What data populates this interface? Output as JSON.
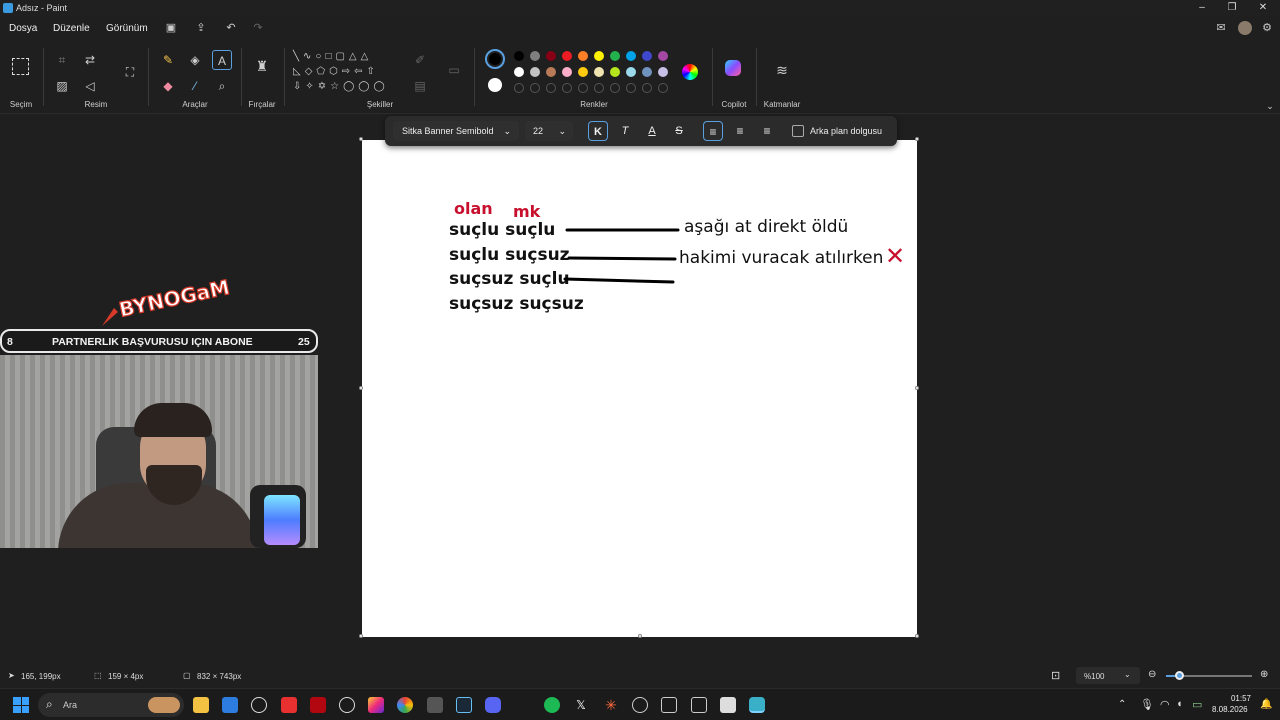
{
  "window": {
    "title": "Adsız - Paint"
  },
  "menu": {
    "file": "Dosya",
    "edit": "Düzenle",
    "view": "Görünüm"
  },
  "ribbon": {
    "groups": {
      "selection": "Seçim",
      "image": "Resim",
      "tools": "Araçlar",
      "brushes": "Fırçalar",
      "shapes": "Şekiller",
      "colors": "Renkler",
      "copilot": "Copilot",
      "layers": "Katmanlar"
    },
    "colors": {
      "row1": [
        "#000000",
        "#7f7f7f",
        "#880015",
        "#ed1c24",
        "#ff7f27",
        "#fff200",
        "#22b14c",
        "#00a2e8",
        "#3f48cc",
        "#a349a4"
      ],
      "row2": [
        "#ffffff",
        "#c3c3c3",
        "#b97a57",
        "#ffaec9",
        "#ffc90e",
        "#efe4b0",
        "#b5e61d",
        "#99d9ea",
        "#7092be",
        "#c8bfe7"
      ],
      "primary": "#000000",
      "secondary": "#ffffff"
    }
  },
  "text_toolbar": {
    "font": "Sitka Banner Semibold",
    "size": "22",
    "bold": "K",
    "italic": "T",
    "underline": "A",
    "strike": "S",
    "bg_fill_label": "Arka plan dolgusu"
  },
  "canvas_content": {
    "labels": {
      "l1": "olan",
      "l2": "mk"
    },
    "left": [
      "suçlu suçlu",
      "suçlu suçsuz",
      "suçsuz suçlu",
      "suçsuz suçsuz"
    ],
    "right": [
      "aşağı at direkt öldü",
      "hakimi vuracak atılırken"
    ],
    "mark": "✕"
  },
  "overlay": {
    "logo_text": "BYNOGaM",
    "banner_left": "8",
    "banner_text": "PARTNERLIK BAŞVURUSU IÇIN ABONE",
    "banner_right": "25"
  },
  "status": {
    "cursor": "165, 199px",
    "selection": "159 × 4px",
    "canvas_size": "832 × 743px",
    "zoom": "%100"
  },
  "taskbar": {
    "search_placeholder": "Ara",
    "time": "01:57",
    "date": "8.08.2026"
  }
}
